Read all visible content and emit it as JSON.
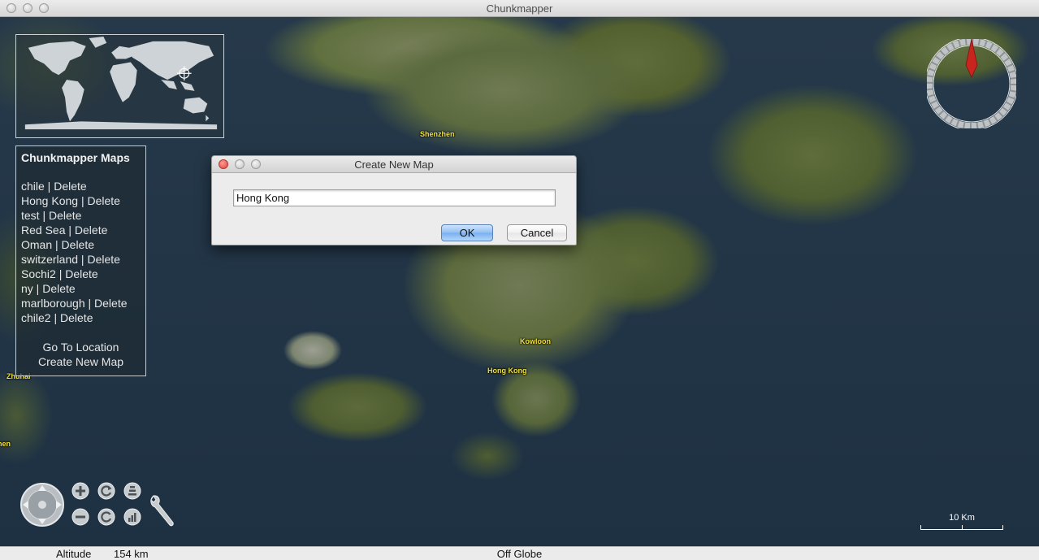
{
  "window": {
    "title": "Chunkmapper"
  },
  "map_labels": {
    "shenzhen": "Shenzhen",
    "kowloon": "Kowloon",
    "hong_kong": "Hong Kong",
    "zhuhai": "Zhuhai",
    "edge_label": "nen"
  },
  "maps_panel": {
    "title": "Chunkmapper Maps",
    "separator": " | ",
    "delete_label": "Delete",
    "items": [
      "chile",
      "Hong Kong",
      "test",
      "Red Sea",
      "Oman",
      "switzerland",
      "Sochi2",
      "ny",
      "marlborough",
      "chile2"
    ],
    "go_to_location": "Go To Location",
    "create_new_map": "Create New Map"
  },
  "dialog": {
    "title": "Create New Map",
    "input_value": "Hong Kong",
    "ok_label": "OK",
    "cancel_label": "Cancel"
  },
  "scale": {
    "label": "10 Km"
  },
  "status": {
    "altitude_label": "Altitude",
    "altitude_value": "154 km",
    "position": "Off Globe"
  },
  "colors": {
    "label_yellow": "#f2e23a",
    "compass_needle": "#c8251f",
    "ok_button": "#8fbff3"
  },
  "icons": [
    "compass-icon",
    "pan-control-icon",
    "zoom-in-icon",
    "zoom-out-icon",
    "rotate-left-icon",
    "rotate-right-icon",
    "tilt-up-icon",
    "tilt-down-icon",
    "wrench-icon",
    "crosshair-icon"
  ]
}
